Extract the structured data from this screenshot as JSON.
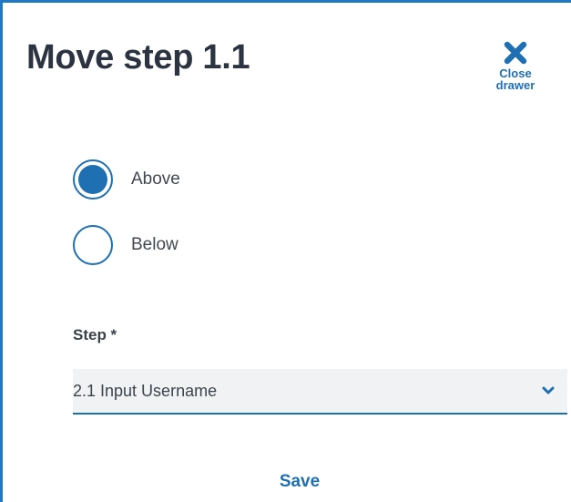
{
  "drawer": {
    "title": "Move step 1.1",
    "close_label": "Close\ndrawer",
    "close_icon": "close-icon"
  },
  "position": {
    "options": [
      {
        "label": "Above",
        "selected": true
      },
      {
        "label": "Below",
        "selected": false
      }
    ]
  },
  "step_field": {
    "label": "Step *",
    "value": "2.1 Input Username",
    "icon": "chevron-down-icon"
  },
  "actions": {
    "save_label": "Save"
  },
  "colors": {
    "accent": "#1f6fb3",
    "border": "#1f78c1",
    "title": "#2b3440",
    "field_bg": "#f1f2f3"
  }
}
